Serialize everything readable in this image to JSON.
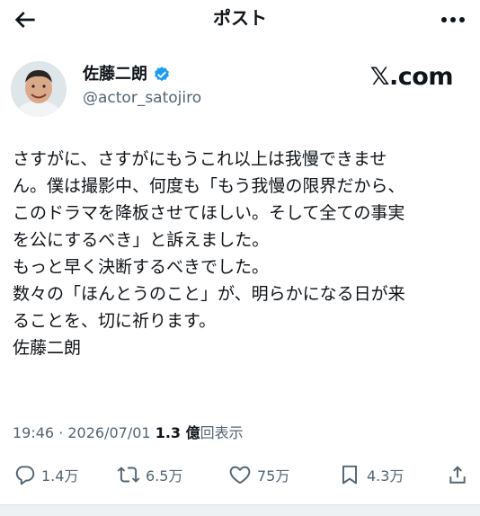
{
  "header": {
    "title": "ポスト",
    "back_icon": "arrow-left-icon",
    "more_icon": "more-horizontal-icon"
  },
  "author": {
    "name": "佐藤二朗",
    "handle": "@actor_satojiro",
    "verified": true,
    "verified_color": "#1d9bf0"
  },
  "brand": {
    "logo_text": "𝕏.com"
  },
  "post": {
    "lines": [
      "さすがに、さすがにもうこれ以上は我慢できませ",
      "ん。僕は撮影中、何度も「もう我慢の限界だから、",
      "このドラマを降板させてほしい。そして全ての事実",
      "を公にするべき」と訴えました。",
      "もっと早く決断するべきでした。",
      "数々の「ほんとうのこと」が、明らかになる日が来",
      "ることを、切に祈ります。",
      "佐藤二朗"
    ]
  },
  "meta": {
    "time": "19:46",
    "separator": " · ",
    "date": "2026/07/01",
    "views": "1.3 億",
    "views_label": "回表示"
  },
  "actions": {
    "reply": {
      "icon": "reply-icon",
      "count": "1.4万"
    },
    "repost": {
      "icon": "repost-icon",
      "count": "6.5万"
    },
    "like": {
      "icon": "heart-icon",
      "count": "75万"
    },
    "bookmark": {
      "icon": "bookmark-icon",
      "count": "4.3万"
    },
    "share": {
      "icon": "share-icon"
    }
  }
}
